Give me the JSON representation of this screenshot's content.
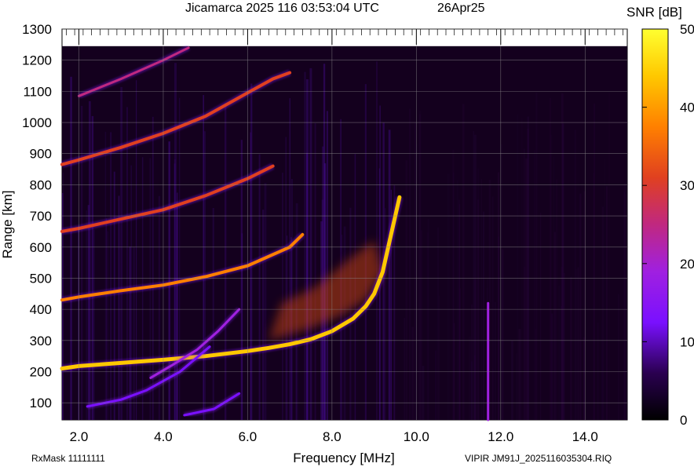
{
  "chart_data": {
    "type": "heatmap",
    "title": "Jicamarca 2025 116 03:53:04 UTC",
    "date_label": "26Apr25",
    "xlabel": "Frequency [MHz]",
    "ylabel": "Range [km]",
    "xlim": [
      1.6,
      15.0
    ],
    "ylim": [
      45,
      1300
    ],
    "data_ylim_top": 1245,
    "x_ticks": [
      2.0,
      4.0,
      6.0,
      8.0,
      10.0,
      12.0,
      14.0
    ],
    "x_tick_labels": [
      "2.0",
      "4.0",
      "6.0",
      "8.0",
      "10.0",
      "12.0",
      "14.0"
    ],
    "y_ticks": [
      100,
      200,
      300,
      400,
      500,
      600,
      700,
      800,
      900,
      1000,
      1100,
      1200,
      1300
    ],
    "y_tick_labels": [
      "100",
      "200",
      "300",
      "400",
      "500",
      "600",
      "700",
      "800",
      "900",
      "1000",
      "1100",
      "1200",
      "1300"
    ],
    "grid": true,
    "colorbar": {
      "label": "SNR [dB]",
      "range": [
        0,
        50
      ],
      "ticks": [
        0,
        10,
        20,
        30,
        40,
        50
      ],
      "tick_labels": [
        "0",
        "10",
        "20",
        "30",
        "40",
        "50"
      ],
      "colormap": [
        "#000000",
        "#3d0066",
        "#8a1aff",
        "#b020b0",
        "#e03030",
        "#ff8a00",
        "#ffe000",
        "#ffff40"
      ]
    },
    "traces": [
      {
        "name": "",
        "points": [
          [
            1.6,
            210
          ],
          [
            2.0,
            218
          ],
          [
            3.0,
            228
          ],
          [
            4.0,
            238
          ],
          [
            5.0,
            250
          ],
          [
            6.0,
            266
          ],
          [
            6.5,
            276
          ],
          [
            7.0,
            288
          ],
          [
            7.5,
            304
          ],
          [
            8.0,
            330
          ],
          [
            8.5,
            370
          ],
          [
            8.8,
            410
          ],
          [
            9.0,
            450
          ],
          [
            9.2,
            520
          ],
          [
            9.4,
            640
          ],
          [
            9.6,
            760
          ]
        ],
        "snr": 42
      },
      {
        "name": "",
        "points": [
          [
            1.6,
            430
          ],
          [
            2.0,
            440
          ],
          [
            3.0,
            460
          ],
          [
            4.0,
            478
          ],
          [
            5.0,
            505
          ],
          [
            6.0,
            540
          ],
          [
            7.0,
            600
          ],
          [
            7.3,
            640
          ]
        ],
        "snr": 36
      },
      {
        "name": "",
        "points": [
          [
            1.6,
            650
          ],
          [
            2.0,
            660
          ],
          [
            3.0,
            690
          ],
          [
            4.0,
            720
          ],
          [
            5.0,
            765
          ],
          [
            6.0,
            820
          ],
          [
            6.6,
            860
          ]
        ],
        "snr": 30
      },
      {
        "name": "",
        "points": [
          [
            1.6,
            865
          ],
          [
            2.0,
            880
          ],
          [
            3.0,
            920
          ],
          [
            4.0,
            965
          ],
          [
            5.0,
            1020
          ],
          [
            6.0,
            1095
          ],
          [
            6.6,
            1140
          ],
          [
            7.0,
            1160
          ]
        ],
        "snr": 26
      },
      {
        "name": "",
        "points": [
          [
            2.0,
            1085
          ],
          [
            3.0,
            1140
          ],
          [
            4.0,
            1200
          ],
          [
            4.6,
            1240
          ]
        ],
        "snr": 24
      },
      {
        "name": "",
        "points": [
          [
            3.7,
            180
          ],
          [
            4.2,
            220
          ],
          [
            4.8,
            270
          ],
          [
            5.3,
            330
          ],
          [
            5.8,
            400
          ]
        ],
        "snr": 14
      },
      {
        "name": "",
        "points": [
          [
            2.2,
            88
          ],
          [
            3.0,
            110
          ],
          [
            3.6,
            140
          ],
          [
            4.4,
            200
          ],
          [
            5.1,
            280
          ]
        ],
        "snr": 12
      },
      {
        "name": "",
        "points": [
          [
            4.5,
            60
          ],
          [
            5.2,
            80
          ],
          [
            5.8,
            130
          ]
        ],
        "snr": 10
      },
      {
        "name": "",
        "points": [
          [
            11.7,
            45
          ],
          [
            11.7,
            420
          ]
        ],
        "snr": 14
      }
    ]
  },
  "footer": {
    "rx_mask": "RxMask 11111111",
    "file_label": "VIPIR  JM91J_2025116035304.RIQ"
  }
}
